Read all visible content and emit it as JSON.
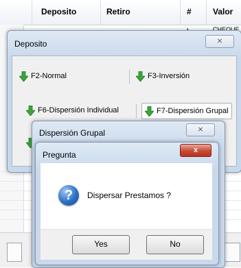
{
  "table": {
    "columns": [
      "Deposito",
      "Retiro",
      "#",
      "Valor"
    ],
    "first_row": {
      "num": "1",
      "valor": "CHEQUE"
    }
  },
  "deposito_window": {
    "title": "Deposito",
    "close_symbol": "⨯",
    "buttons": [
      {
        "label": "F2-Normal",
        "icon": "green-down-arrow-icon"
      },
      {
        "label": "F3-Inversión",
        "icon": "green-down-arrow-icon"
      },
      {
        "label": "F6-Dispersión Individual",
        "icon": "green-down-arrow-icon"
      },
      {
        "label": "F7-Dispersión Grupal",
        "icon": "green-down-arrow-icon"
      }
    ]
  },
  "dispersion_window": {
    "title": "Dispersión Grupal",
    "close_symbol": "⨯"
  },
  "pregunta_dialog": {
    "title": "Pregunta",
    "close_symbol": "x",
    "icon": "question-icon",
    "message": "Dispersar Prestamos ?",
    "yes_label": "Yes",
    "no_label": "No"
  },
  "colors": {
    "arrow_green": "#3aa53a",
    "accent_blue": "#2c6fc4",
    "close_red": "#c94a34"
  }
}
